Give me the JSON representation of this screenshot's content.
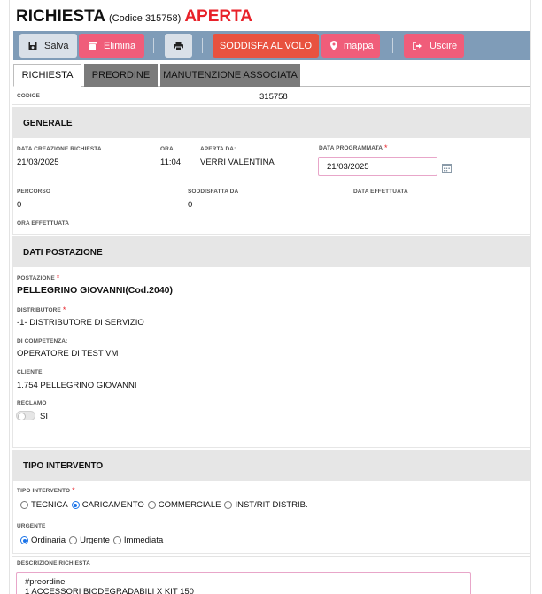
{
  "header": {
    "title": "RICHIESTA",
    "code_note": "(Codice 315758)",
    "status": "APERTA"
  },
  "toolbar": {
    "save_label": "Salva",
    "delete_label": "Elimina",
    "satisfy_label": "SODDISFA AL VOLO",
    "map_label": "mappa",
    "exit_label": "Uscire"
  },
  "tabs": {
    "richiesta": "RICHIESTA",
    "preordine": "PREORDINE",
    "manutenzione": "MANUTENZIONE ASSOCIATA"
  },
  "codice": {
    "label": "CODICE",
    "value": "315758"
  },
  "generale": {
    "title": "GENERALE",
    "data_creazione_label": "DATA CREAZIONE RICHIESTA",
    "data_creazione_value": "21/03/2025",
    "ora_label": "ORA",
    "ora_value": "11:04",
    "aperta_da_label": "APERTA DA:",
    "aperta_da_value": "VERRI VALENTINA",
    "data_programmata_label": "DATA PROGRAMMATA",
    "data_programmata_value": "21/03/2025",
    "percorso_label": "PERCORSO",
    "percorso_value": "0",
    "soddisfatta_da_label": "SODDISFATTA DA",
    "soddisfatta_da_value": "0",
    "data_effettuata_label": "DATA EFFETTUATA",
    "ora_effettuata_label": "ORA EFFETTUATA"
  },
  "postazione": {
    "title": "DATI POSTAZIONE",
    "postazione_label": "POSTAZIONE",
    "postazione_value": "PELLEGRINO GIOVANNI(Cod.2040)",
    "distributore_label": "DISTRIBUTORE",
    "distributore_value": "-1- DISTRIBUTORE DI SERVIZIO",
    "competenza_label": "DI COMPETENZA:",
    "competenza_value": "OPERATORE DI TEST VM",
    "cliente_label": "CLIENTE",
    "cliente_value": "1.754 PELLEGRINO GIOVANNI",
    "reclamo_label": "RECLAMO",
    "reclamo_toggle_label": "SI",
    "reclamo_on": false
  },
  "intervento": {
    "title": "TIPO INTERVENTO",
    "tipo_label": "TIPO INTERVENTO",
    "tipo_options": [
      "TECNICA",
      "CARICAMENTO",
      "COMMERCIALE",
      "INST/RIT DISTRIB."
    ],
    "tipo_selected": "CARICAMENTO",
    "urgente_label": "URGENTE",
    "urgente_options": [
      "Ordinaria",
      "Urgente",
      "Immediata"
    ],
    "urgente_selected": "Ordinaria"
  },
  "descrizione": {
    "label": "DESCRIZIONE RICHIESTA",
    "line1": "#preordine",
    "line2": "1 ACCESSORI BIODEGRADABILI X KIT 150"
  },
  "colors": {
    "status": "#e8222a",
    "toolbar": "#7f9cb8",
    "danger_button": "#f05d7a",
    "satisfy_button": "#e8523f",
    "section_header": "#e6e6e6",
    "radio_checked": "#1a73e8"
  }
}
